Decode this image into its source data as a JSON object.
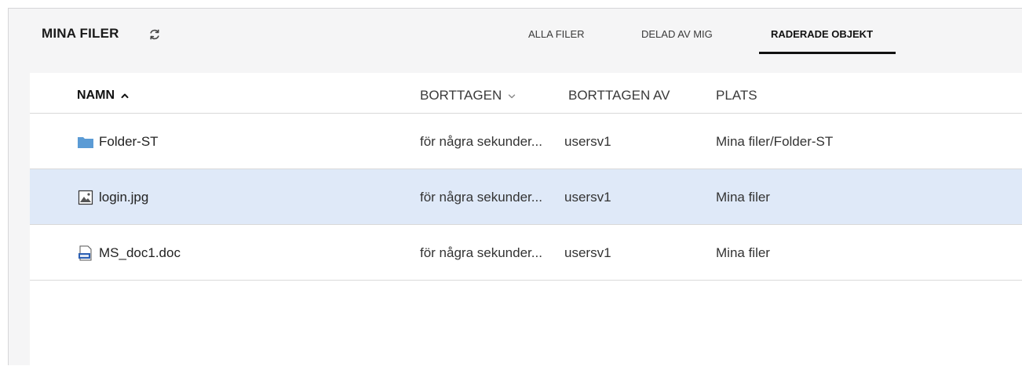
{
  "header": {
    "title": "MINA FILER",
    "refresh_icon": "refresh-icon",
    "tabs": [
      {
        "label": "ALLA FILER",
        "active": false
      },
      {
        "label": "DELAD AV MIG",
        "active": false
      },
      {
        "label": "RADERADE OBJEKT",
        "active": true
      }
    ]
  },
  "table": {
    "columns": {
      "name": "NAMN",
      "deleted": "BORTTAGEN",
      "deleted_by": "BORTTAGEN AV",
      "location": "PLATS"
    },
    "rows": [
      {
        "name": "Folder-ST",
        "icon": "folder-icon",
        "deleted": "för några sekunder...",
        "deleted_by": "usersv1",
        "location": "Mina filer/Folder-ST",
        "selected": false
      },
      {
        "name": "login.jpg",
        "icon": "image-file-icon",
        "deleted": "för några sekunder...",
        "deleted_by": "usersv1",
        "location": "Mina filer",
        "selected": true
      },
      {
        "name": "MS_doc1.doc",
        "icon": "doc-file-icon",
        "deleted": "för några sekunder...",
        "deleted_by": "usersv1",
        "location": "Mina filer",
        "selected": false
      }
    ]
  },
  "colors": {
    "panel_bg": "#f5f5f6",
    "selected_row": "#dfe9f8",
    "folder": "#5b9bd5",
    "doc_icon": "#2b5fb3"
  }
}
